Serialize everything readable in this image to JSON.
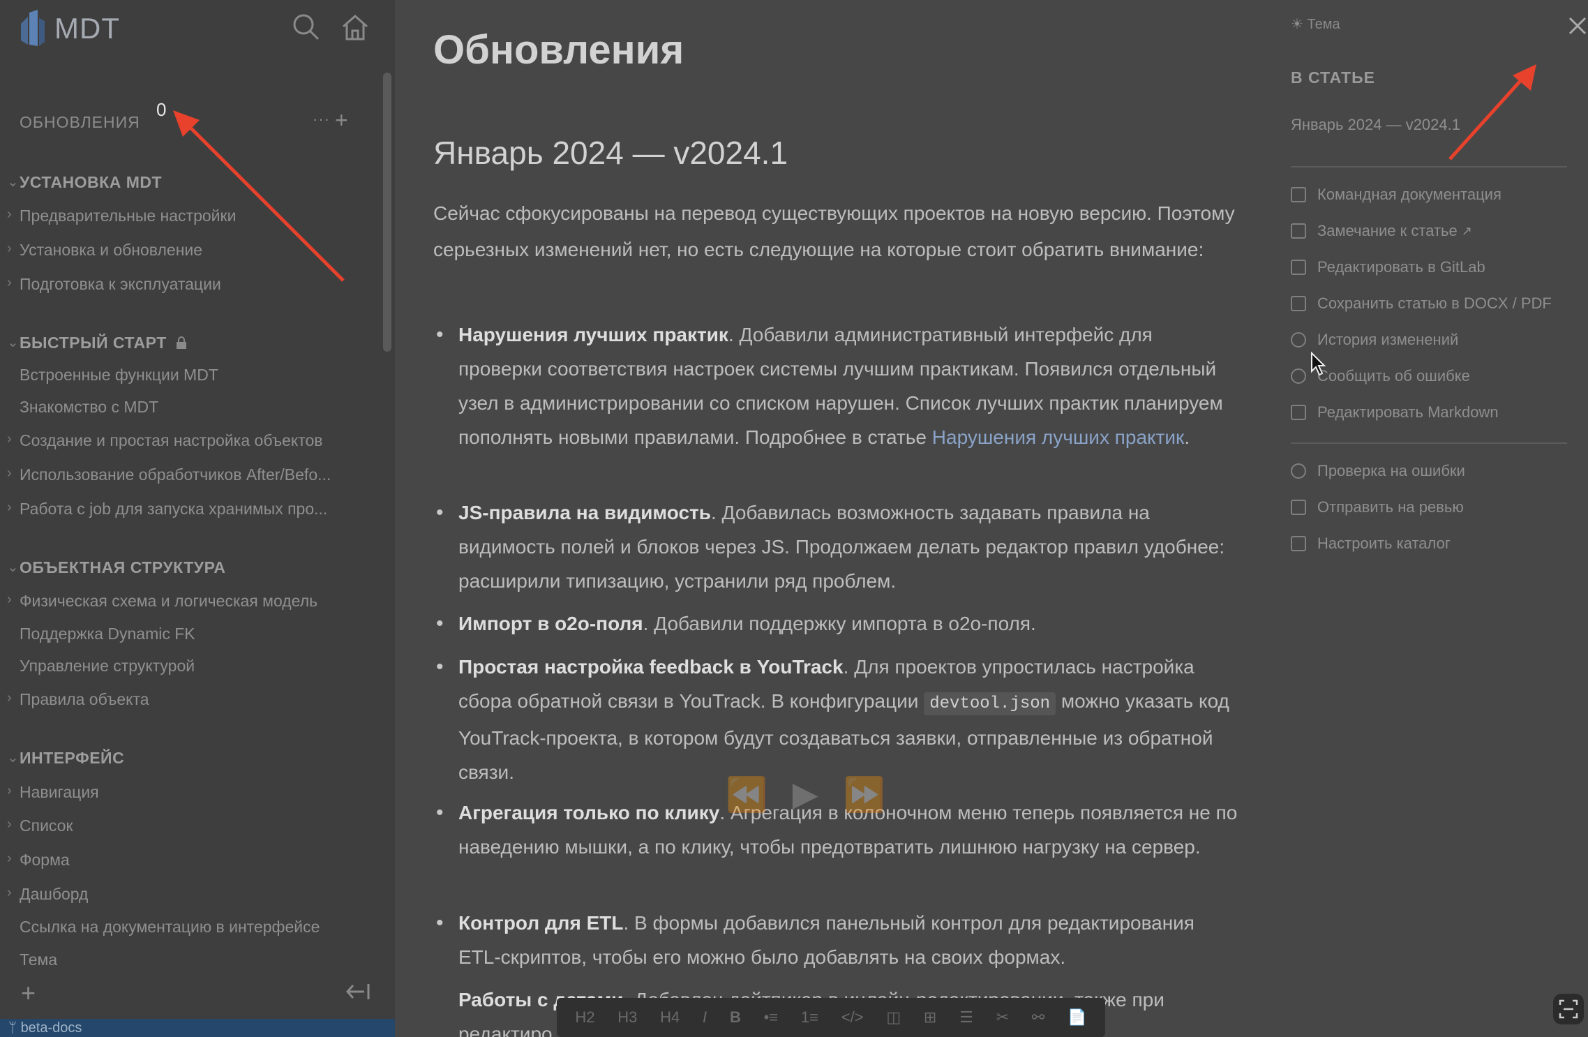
{
  "app": {
    "title": "MDT",
    "branch": "beta-docs"
  },
  "sidebar": {
    "header": {
      "label": "ОБНОВЛЕНИЯ",
      "badge": "0"
    },
    "sections": [
      {
        "title": "УСТАНОВКА MDT",
        "items": [
          {
            "label": "Предварительные настройки",
            "expandable": true
          },
          {
            "label": "Установка и обновление",
            "expandable": true
          },
          {
            "label": "Подготовка к эксплуатации",
            "expandable": true
          }
        ]
      },
      {
        "title": "БЫСТРЫЙ СТАРТ",
        "items": [
          {
            "label": "Встроенные функции MDT",
            "expandable": false
          },
          {
            "label": "Знакомство с MDT",
            "expandable": false
          },
          {
            "label": "Создание и простая настройка объектов",
            "expandable": true
          },
          {
            "label": "Использование обработчиков After/Befo...",
            "expandable": true
          },
          {
            "label": "Работа с job для запуска хранимых про...",
            "expandable": true
          }
        ]
      },
      {
        "title": "ОБЪЕКТНАЯ СТРУКТУРА",
        "items": [
          {
            "label": "Физическая схема и логическая модель",
            "expandable": true
          },
          {
            "label": "Поддержка Dynamic FK",
            "expandable": false
          },
          {
            "label": "Управление структурой",
            "expandable": false
          },
          {
            "label": "Правила объекта",
            "expandable": true
          }
        ]
      },
      {
        "title": "ИНТЕРФЕЙС",
        "items": [
          {
            "label": "Навигация",
            "expandable": true
          },
          {
            "label": "Список",
            "expandable": true
          },
          {
            "label": "Форма",
            "expandable": true
          },
          {
            "label": "Дашборд",
            "expandable": true
          },
          {
            "label": "Ссылка на документацию в интерфейсе",
            "expandable": false
          },
          {
            "label": "Тема",
            "expandable": false
          }
        ]
      }
    ]
  },
  "article": {
    "title": "Обновления",
    "subtitle": "Январь 2024 — v2024.1",
    "intro": "Сейчас сфокусированы на перевод существующих проектов на новую версию. Поэтому серьезных изменений нет, но есть следующие на которые стоит обратить внимание:",
    "items": [
      {
        "bold": "Нарушения лучших практик",
        "text": ".  Добавили административный интерфейс для проверки соответствия настроек системы лучшим практикам. Появился отдельный узел в администрировании со списком нарушен. Список лучших практик планируем пополнять новыми правилами. Подробнее в статье ",
        "link": "Нарушения лучших практик",
        "after": "."
      },
      {
        "bold": "JS-правила на видимость",
        "text": ". Добавилась возможность задавать правила на видимость полей и блоков через JS. Продолжаем делать редактор правил удобнее: расширили типизацию, устранили ряд проблем."
      },
      {
        "bold": "Импорт в o2o-поля",
        "text": ". Добавили поддержку импорта в o2o-поля."
      },
      {
        "bold": "Простая настройка feedback в YouTrack",
        "text": ". Для проектов упростилась настройка сбора обратной связи в YouTrack. В конфигурации ",
        "code": "devtool.json",
        "after": " можно указать код YouTrack-проекта, в котором будут создаваться заявки, отправленные из обратной связи."
      },
      {
        "bold": "Агрегация только по клику",
        "text": ". Агрегация в колоночном меню теперь появляется не по наведению мышки, а по клику, чтобы предотвратить лишнюю нагрузку на сервер."
      },
      {
        "bold": "Контрол для ETL",
        "text": ". В формы добавился панельный контрол для редактирования ETL-скриптов, чтобы его можно было добавлять на своих формах."
      },
      {
        "bold": "Работы с детами",
        "text": ". Добавлен дейтпикер в инлайн-редактировании, также при редактиро..."
      }
    ]
  },
  "toc": {
    "theme_label": "Тема",
    "heading": "В СТАТЬЕ",
    "anchors": [
      "Январь 2024 — v2024.1"
    ],
    "actions": [
      {
        "label": "Командная документация",
        "icon": "book-icon"
      },
      {
        "label": "Замечание к статье",
        "icon": "mail-icon",
        "external": true
      },
      {
        "label": "Редактировать в GitLab",
        "icon": "pencil-icon"
      },
      {
        "label": "Сохранить статью в DOCX / PDF",
        "icon": "file-icon"
      },
      {
        "label": "История изменений",
        "icon": "history-icon"
      },
      {
        "label": "Сообщить об ошибке",
        "icon": "bug-icon"
      },
      {
        "label": "Редактировать Markdown",
        "icon": "markdown-icon"
      }
    ],
    "actions2": [
      {
        "label": "Проверка на ошибки",
        "icon": "check-icon"
      },
      {
        "label": "Отправить на ревью",
        "icon": "share-icon"
      },
      {
        "label": "Настроить каталог",
        "icon": "edit-icon"
      }
    ]
  },
  "format_toolbar": [
    "H2",
    "H3",
    "H4",
    "I",
    "B",
    "•≡",
    "1≡",
    "</>",
    "◫",
    "⊞",
    "☰",
    "✂",
    "⚯",
    "📄"
  ],
  "colors": {
    "sidebar_bg": "#3e3e3e",
    "main_bg": "#474747",
    "status_bar": "#24476b",
    "annotation_arrow": "#e8412c"
  }
}
